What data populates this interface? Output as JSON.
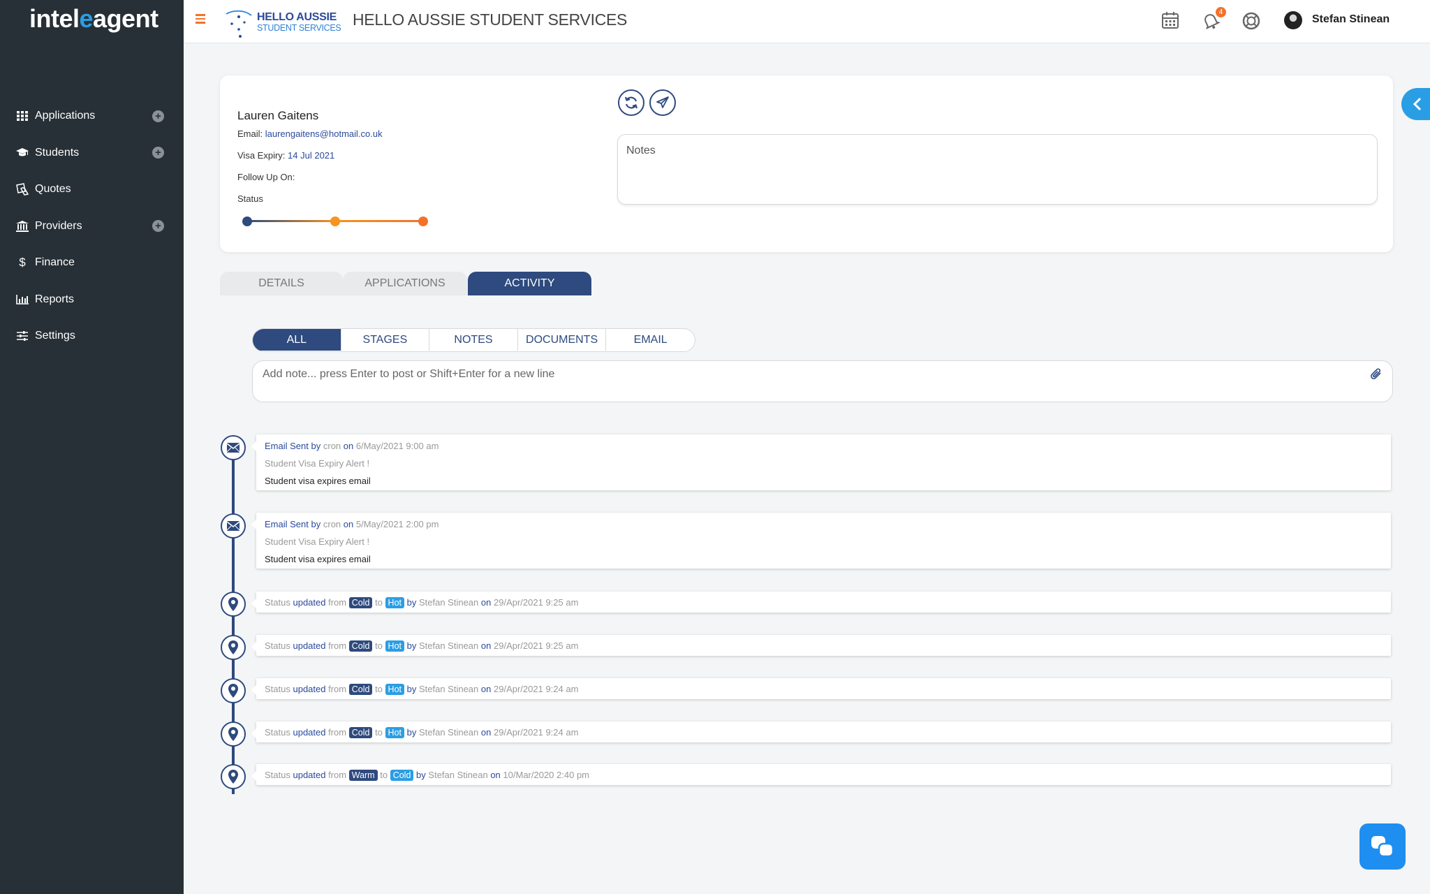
{
  "brand": {
    "logo_left": "intel",
    "logo_mid": "e",
    "logo_right": "agent"
  },
  "sidebar": {
    "items": [
      {
        "label": "Applications",
        "icon": "grid-icon",
        "plus": true
      },
      {
        "label": "Students",
        "icon": "graduation-cap-icon",
        "plus": true
      },
      {
        "label": "Quotes",
        "icon": "quotes-icon",
        "plus": false
      },
      {
        "label": "Providers",
        "icon": "institution-icon",
        "plus": true
      },
      {
        "label": "Finance",
        "icon": "dollar-icon",
        "plus": false
      },
      {
        "label": "Reports",
        "icon": "bar-chart-icon",
        "plus": false
      },
      {
        "label": "Settings",
        "icon": "sliders-icon",
        "plus": false
      }
    ]
  },
  "topbar": {
    "company_line1": "HELLO AUSSIE",
    "company_line2": "STUDENT SERVICES",
    "title": "HELLO AUSSIE STUDENT SERVICES",
    "notification_count": "4",
    "user_name": "Stefan Stinean"
  },
  "student": {
    "name": "Lauren Gaitens",
    "email_label": "Email:",
    "email": "laurengaitens@hotmail.co.uk",
    "visa_label": "Visa Expiry:",
    "visa_expiry": "14 Jul 2021",
    "follow_up_label": "Follow Up On:",
    "status_label": "Status",
    "notes_placeholder": "Notes"
  },
  "tabs": [
    "DETAILS",
    "APPLICATIONS",
    "ACTIVITY"
  ],
  "filters": [
    "ALL",
    "STAGES",
    "NOTES",
    "DOCUMENTS",
    "EMAIL"
  ],
  "add_note_placeholder": "Add note... press Enter to post or Shift+Enter for a new line",
  "words": {
    "email_sent": "Email Sent",
    "by": "by",
    "on": "on",
    "status": "Status",
    "updated": "updated",
    "from": "from",
    "to": "to"
  },
  "emails": [
    {
      "by": "cron",
      "date": "6/May/2021 9:00 am",
      "subject": "Student Visa Expiry Alert !",
      "body": "Student visa expires email"
    },
    {
      "by": "cron",
      "date": "5/May/2021 2:00 pm",
      "subject": "Student Visa Expiry Alert !",
      "body": "Student visa expires email"
    }
  ],
  "status_updates": [
    {
      "from": "Cold",
      "to": "Hot",
      "by": "Stefan Stinean",
      "date": "29/Apr/2021 9:25 am"
    },
    {
      "from": "Cold",
      "to": "Hot",
      "by": "Stefan Stinean",
      "date": "29/Apr/2021 9:25 am"
    },
    {
      "from": "Cold",
      "to": "Hot",
      "by": "Stefan Stinean",
      "date": "29/Apr/2021 9:24 am"
    },
    {
      "from": "Cold",
      "to": "Hot",
      "by": "Stefan Stinean",
      "date": "29/Apr/2021 9:24 am"
    },
    {
      "from": "Warm",
      "to": "Cold",
      "by": "Stefan Stinean",
      "date": "10/Mar/2020 2:40 pm"
    }
  ],
  "colors": {
    "primary": "#2e4a7e",
    "accent": "#2a9ee4",
    "orange": "#f3722b",
    "sidebar": "#273036"
  }
}
